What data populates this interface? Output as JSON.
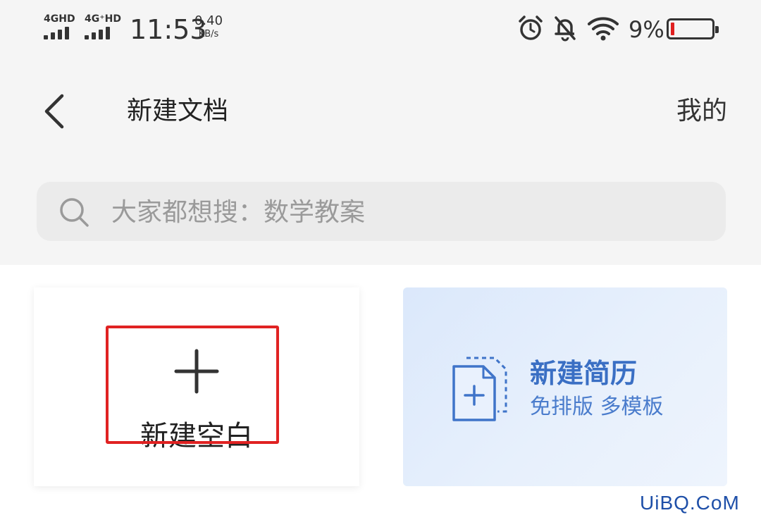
{
  "status_bar": {
    "signal1_label": "4GHD",
    "signal2_label": "4G⁺HD",
    "time": "11:53",
    "net_speed_value": "0.40",
    "net_speed_unit": "KB/s",
    "battery_percent": "9%",
    "battery_level": 0.09,
    "icons": [
      "alarm-icon",
      "bell-off-icon",
      "wifi-icon",
      "battery-icon"
    ]
  },
  "header": {
    "title": "新建文档",
    "mine_label": "我的"
  },
  "search": {
    "placeholder": "大家都想搜：数学教案"
  },
  "cards": {
    "blank": {
      "label": "新建空白"
    },
    "resume": {
      "title": "新建简历",
      "subtitle": "免排版 多模板"
    }
  },
  "watermark": "UiBQ.CoM",
  "colors": {
    "highlight": "#e02222",
    "resume_text": "#3a6fc4",
    "battery_low": "#e02020"
  }
}
